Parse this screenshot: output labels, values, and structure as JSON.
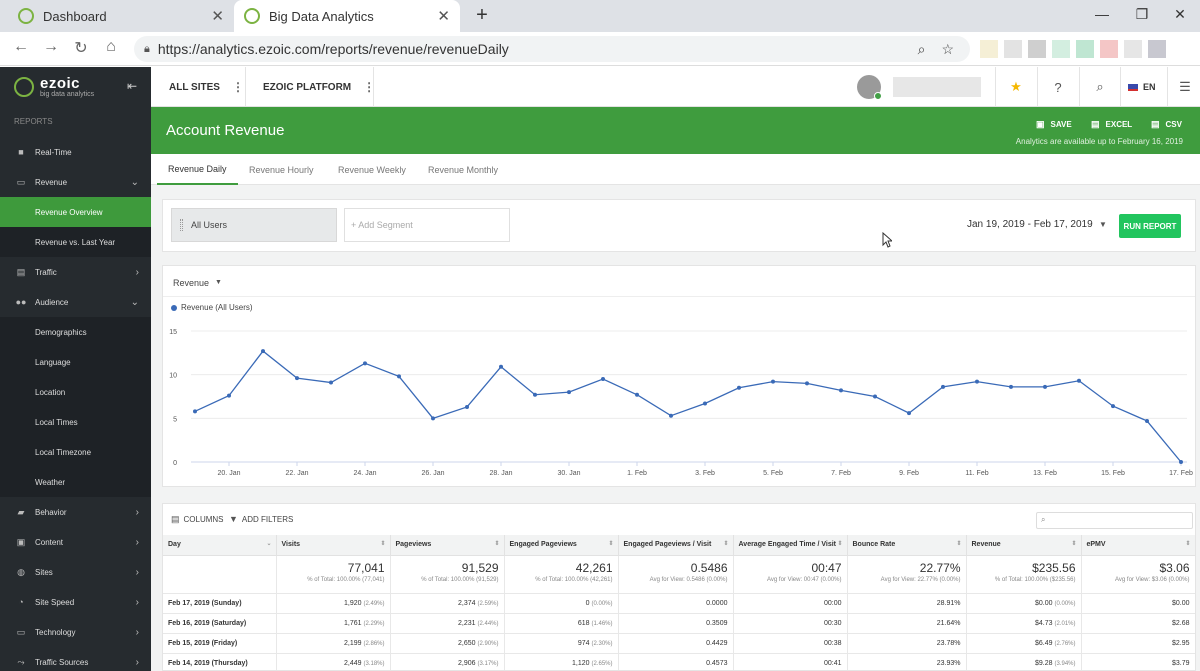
{
  "browser": {
    "tabs": [
      {
        "label": "Dashboard",
        "close": "✕"
      },
      {
        "label": "Big Data Analytics",
        "close": "✕"
      }
    ],
    "new_tab": "+",
    "window_controls": {
      "minimize": "—",
      "restore": "❐",
      "close": "✕"
    },
    "url": "https://analytics.ezoic.com/reports/revenue/revenueDaily",
    "extension_colors": [
      "#f5efd6",
      "#e3e3e3",
      "#cfcfcf",
      "#d3eee0",
      "#bfe6d2",
      "#f4c6c6",
      "#e6e6e6",
      "#c8c8d0"
    ]
  },
  "brand": {
    "name": "ezoic",
    "tagline": "big data analytics",
    "accent": "#3f9c3e"
  },
  "sidebar": {
    "section_label": "REPORTS",
    "items": [
      {
        "label": "Real-Time",
        "icon": "video-icon",
        "glyph": "■",
        "chevron": ""
      },
      {
        "label": "Revenue",
        "icon": "money-icon",
        "glyph": "▭",
        "chevron": "⌄"
      },
      {
        "label": "Revenue Overview",
        "sub": true,
        "active": true
      },
      {
        "label": "Revenue vs. Last Year",
        "sub": true
      },
      {
        "label": "Traffic",
        "icon": "traffic-icon",
        "glyph": "▤",
        "chevron": "›"
      },
      {
        "label": "Audience",
        "icon": "users-icon",
        "glyph": "●●",
        "chevron": "⌄"
      },
      {
        "label": "Demographics",
        "sub": true
      },
      {
        "label": "Language",
        "sub": true
      },
      {
        "label": "Location",
        "sub": true
      },
      {
        "label": "Local Times",
        "sub": true
      },
      {
        "label": "Local Timezone",
        "sub": true
      },
      {
        "label": "Weather",
        "sub": true
      },
      {
        "label": "Behavior",
        "icon": "behavior-icon",
        "glyph": "▰",
        "chevron": "›"
      },
      {
        "label": "Content",
        "icon": "content-icon",
        "glyph": "▣",
        "chevron": "›"
      },
      {
        "label": "Sites",
        "icon": "globe-icon",
        "glyph": "◍",
        "chevron": "›"
      },
      {
        "label": "Site Speed",
        "icon": "speed-icon",
        "glyph": "◔",
        "chevron": "›"
      },
      {
        "label": "Technology",
        "icon": "technology-icon",
        "glyph": "▭",
        "chevron": "›"
      },
      {
        "label": "Traffic Sources",
        "icon": "sources-icon",
        "glyph": "⤳",
        "chevron": "›"
      }
    ]
  },
  "header": {
    "site_selector": "ALL SITES",
    "platform_selector": "EZOIC PLATFORM",
    "kebab": "⋮",
    "language": "EN"
  },
  "banner": {
    "title": "Account Revenue",
    "save_label": "SAVE",
    "excel_label": "EXCEL",
    "csv_label": "CSV",
    "availability": "Analytics are available up to February 16, 2019"
  },
  "subtabs": [
    "Revenue Daily",
    "Revenue Hourly",
    "Revenue Weekly",
    "Revenue Monthly"
  ],
  "segment": {
    "selected": "All Users",
    "add_placeholder": "+ Add Segment",
    "date_range": "Jan 19, 2019 - Feb 17, 2019",
    "run_label": "RUN REPORT"
  },
  "chart_panel": {
    "metric": "Revenue"
  },
  "chart_data": {
    "type": "line",
    "series": [
      {
        "name": "Revenue (All Users)",
        "color": "#3a6ab7",
        "values": [
          5.8,
          7.6,
          12.7,
          9.6,
          9.1,
          11.3,
          9.8,
          5.0,
          6.3,
          10.9,
          7.7,
          8.0,
          9.5,
          7.7,
          5.3,
          6.7,
          8.5,
          9.2,
          9.0,
          8.2,
          7.5,
          5.6,
          8.6,
          9.2,
          8.6,
          8.6,
          9.3,
          6.4,
          4.7,
          0.0
        ]
      }
    ],
    "x": [
      "Jan 19",
      "Jan 20",
      "Jan 21",
      "Jan 22",
      "Jan 23",
      "Jan 24",
      "Jan 25",
      "Jan 26",
      "Jan 27",
      "Jan 28",
      "Jan 29",
      "Jan 30",
      "Jan 31",
      "Feb 1",
      "Feb 2",
      "Feb 3",
      "Feb 4",
      "Feb 5",
      "Feb 6",
      "Feb 7",
      "Feb 8",
      "Feb 9",
      "Feb 10",
      "Feb 11",
      "Feb 12",
      "Feb 13",
      "Feb 14",
      "Feb 15",
      "Feb 16",
      "Feb 17"
    ],
    "x_tick_labels": [
      "20. Jan",
      "22. Jan",
      "24. Jan",
      "26. Jan",
      "28. Jan",
      "30. Jan",
      "1. Feb",
      "3. Feb",
      "5. Feb",
      "7. Feb",
      "9. Feb",
      "11. Feb",
      "13. Feb",
      "15. Feb",
      "17. Feb"
    ],
    "y_ticks": [
      0,
      5,
      10,
      15
    ],
    "ylim": [
      0,
      15
    ],
    "grid": true,
    "legend_position": "top-left"
  },
  "table": {
    "columns_label": "COLUMNS",
    "filters_label": "ADD FILTERS",
    "headers": [
      "Day",
      "Visits",
      "Pageviews",
      "Engaged Pageviews",
      "Engaged Pageviews / Visit",
      "Average Engaged Time / Visit",
      "Bounce Rate",
      "Revenue",
      "ePMV"
    ],
    "totals": [
      {
        "value": "",
        "sub": ""
      },
      {
        "value": "77,041",
        "sub": "% of Total: 100.00% (77,041)"
      },
      {
        "value": "91,529",
        "sub": "% of Total: 100.00% (91,529)"
      },
      {
        "value": "42,261",
        "sub": "% of Total: 100.00% (42,261)"
      },
      {
        "value": "0.5486",
        "sub": "Avg for View: 0.5486 (0.00%)"
      },
      {
        "value": "00:47",
        "sub": "Avg for View: 00:47 (0.00%)"
      },
      {
        "value": "22.77%",
        "sub": "Avg for View: 22.77% (0.00%)"
      },
      {
        "value": "$235.56",
        "sub": "% of Total: 100.00% ($235.56)"
      },
      {
        "value": "$3.06",
        "sub": "Avg for View: $3.06 (0.00%)"
      }
    ],
    "rows": [
      [
        {
          "v": "Feb 17, 2019 (Sunday)"
        },
        {
          "v": "1,920",
          "p": "(2.49%)"
        },
        {
          "v": "2,374",
          "p": "(2.59%)"
        },
        {
          "v": "0",
          "p": "(0.00%)"
        },
        {
          "v": "0.0000"
        },
        {
          "v": "00:00"
        },
        {
          "v": "28.91%"
        },
        {
          "v": "$0.00",
          "p": "(0.00%)"
        },
        {
          "v": "$0.00"
        }
      ],
      [
        {
          "v": "Feb 16, 2019 (Saturday)"
        },
        {
          "v": "1,761",
          "p": "(2.29%)"
        },
        {
          "v": "2,231",
          "p": "(2.44%)"
        },
        {
          "v": "618",
          "p": "(1.46%)"
        },
        {
          "v": "0.3509"
        },
        {
          "v": "00:30"
        },
        {
          "v": "21.64%"
        },
        {
          "v": "$4.73",
          "p": "(2.01%)"
        },
        {
          "v": "$2.68"
        }
      ],
      [
        {
          "v": "Feb 15, 2019 (Friday)"
        },
        {
          "v": "2,199",
          "p": "(2.86%)"
        },
        {
          "v": "2,650",
          "p": "(2.90%)"
        },
        {
          "v": "974",
          "p": "(2.30%)"
        },
        {
          "v": "0.4429"
        },
        {
          "v": "00:38"
        },
        {
          "v": "23.78%"
        },
        {
          "v": "$6.49",
          "p": "(2.76%)"
        },
        {
          "v": "$2.95"
        }
      ],
      [
        {
          "v": "Feb 14, 2019 (Thursday)"
        },
        {
          "v": "2,449",
          "p": "(3.18%)"
        },
        {
          "v": "2,906",
          "p": "(3.17%)"
        },
        {
          "v": "1,120",
          "p": "(2.65%)"
        },
        {
          "v": "0.4573"
        },
        {
          "v": "00:41"
        },
        {
          "v": "23.93%"
        },
        {
          "v": "$9.28",
          "p": "(3.94%)"
        },
        {
          "v": "$3.79"
        }
      ]
    ]
  }
}
